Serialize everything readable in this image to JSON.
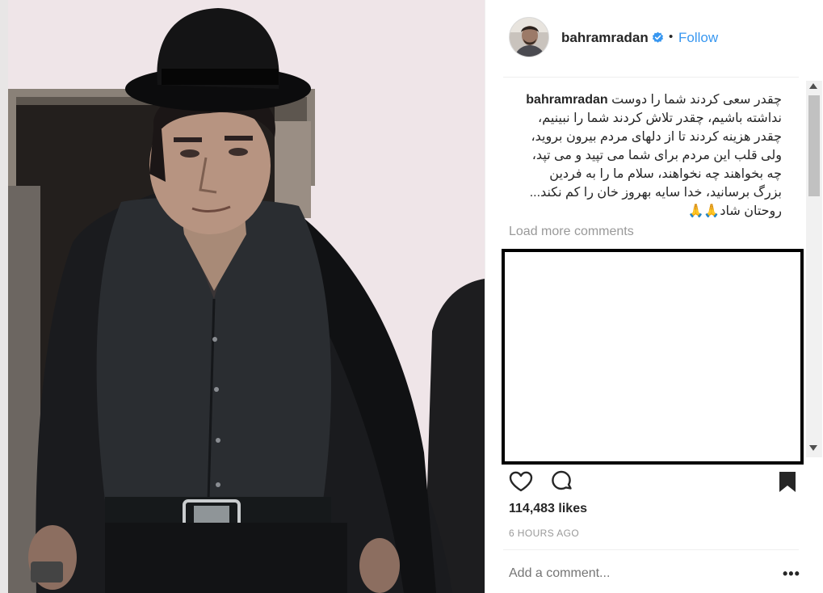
{
  "post": {
    "username": "bahramradan",
    "verified": true,
    "follow_dot": "•",
    "follow_label": "Follow",
    "caption_user": "bahramradan",
    "caption_lines": [
      "چقدر سعی کردند شما را دوست",
      "نداشته باشیم، چقدر تلاش کردند شما را نبینیم،",
      "چقدر هزینه کردند تا از دلهای مردم بیرون بروید،",
      "ولی قلب این مردم برای شما می تپید و می تپد،",
      "چه بخواهند چه نخواهند، سلام ما را به فردین",
      "بزرگ برسانید، خدا سایه بهروز خان را کم نکند...",
      "روحتان شاد🙏🙏"
    ],
    "load_more_label": "Load more comments",
    "likes": "114,483 likes",
    "time": "6 HOURS AGO",
    "add_comment_placeholder": "Add a comment...",
    "more_label": "•••"
  },
  "icons": {
    "verified": "verified-badge-icon",
    "heart": "heart-icon",
    "comment": "comment-icon",
    "bookmark": "bookmark-icon"
  },
  "colors": {
    "link": "#3897f0",
    "verified": "#3897f0",
    "muted": "#999999",
    "text": "#262626"
  }
}
